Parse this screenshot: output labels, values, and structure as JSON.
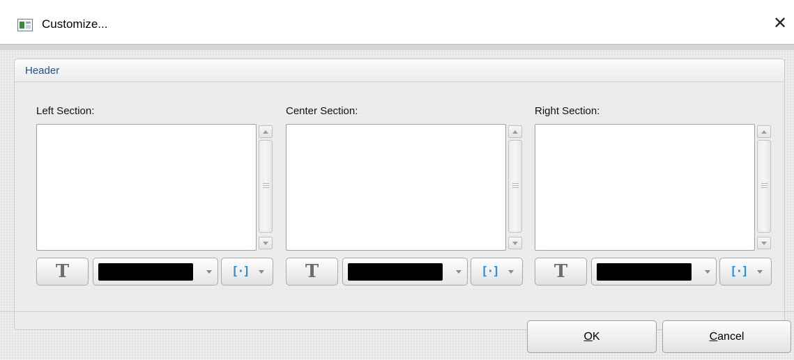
{
  "window": {
    "title": "Customize...",
    "close_glyph": "✕"
  },
  "group": {
    "title": "Header"
  },
  "sections": [
    {
      "label": "Left Section:",
      "text": "",
      "color": "#000000",
      "font_glyph": "T",
      "macro_glyph": "[·]"
    },
    {
      "label": "Center Section:",
      "text": "",
      "color": "#000000",
      "font_glyph": "T",
      "macro_glyph": "[·]"
    },
    {
      "label": "Right Section:",
      "text": "",
      "color": "#000000",
      "font_glyph": "T",
      "macro_glyph": "[·]"
    }
  ],
  "buttons": {
    "ok_mnemonic": "O",
    "ok_rest": "K",
    "cancel_mnemonic": "C",
    "cancel_rest": "ancel"
  },
  "icons": {
    "app": "dialog-app-icon",
    "close": "close-icon",
    "font": "font-format-icon",
    "macro": "insert-macro-icon"
  }
}
